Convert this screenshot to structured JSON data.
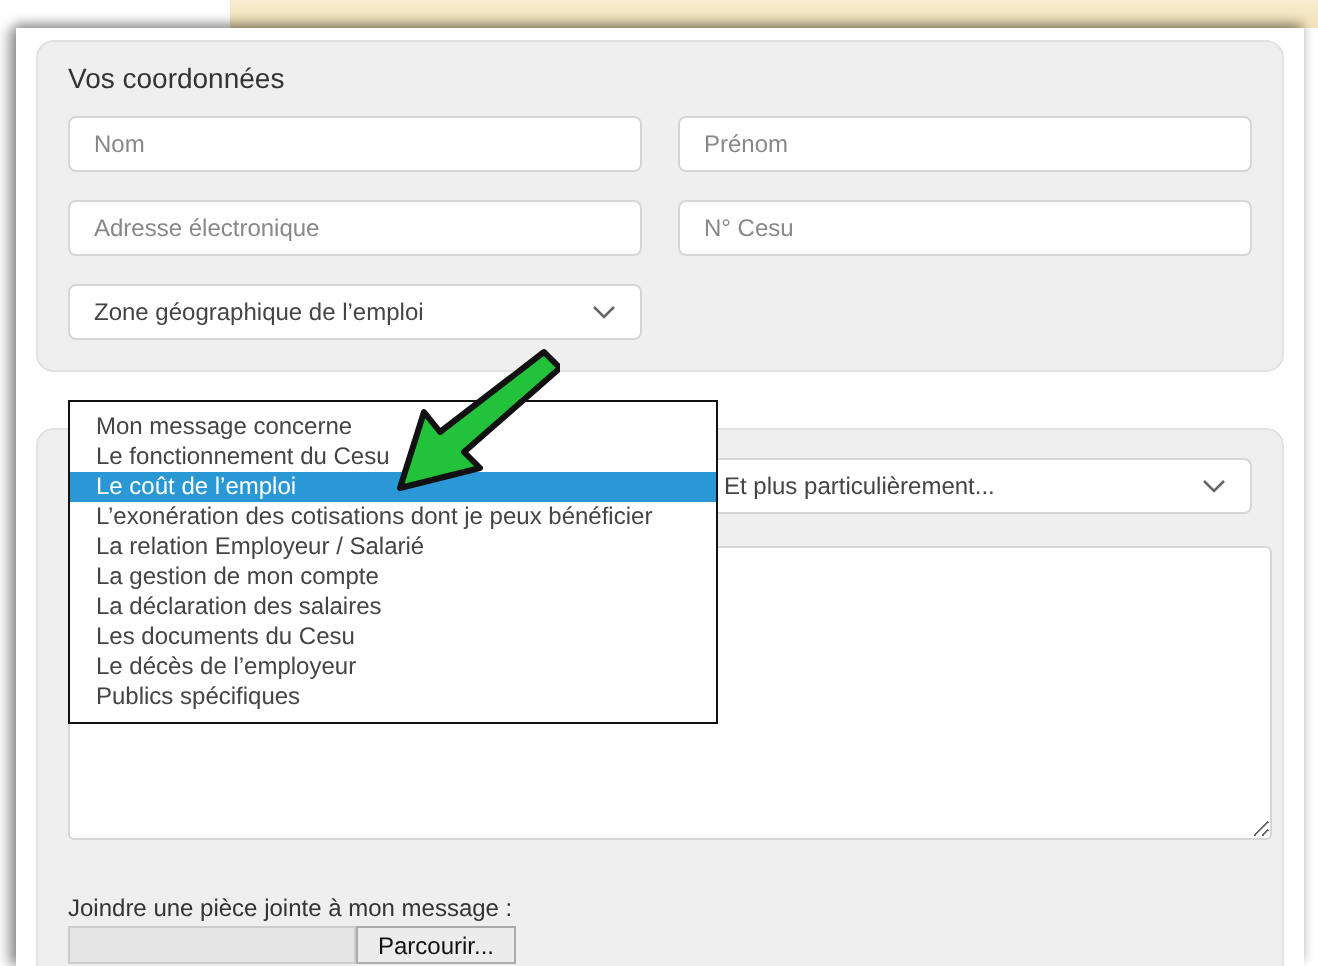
{
  "contact": {
    "title": "Vos coordonnées",
    "fields": [
      {
        "placeholder": "Nom"
      },
      {
        "placeholder": "Prénom"
      },
      {
        "placeholder": "Adresse électronique"
      },
      {
        "placeholder": "N° Cesu"
      }
    ],
    "zone_select": {
      "value": "Zone géographique de l’emploi"
    }
  },
  "message": {
    "topic_dropdown": {
      "options": [
        {
          "label": "Mon message concerne",
          "selected": false
        },
        {
          "label": "Le fonctionnement du Cesu",
          "selected": false
        },
        {
          "label": "Le coût de l’emploi",
          "selected": true
        },
        {
          "label": "L’exonération des cotisations dont je peux bénéficier",
          "selected": false
        },
        {
          "label": "La relation Employeur / Salarié",
          "selected": false
        },
        {
          "label": "La gestion de mon compte",
          "selected": false
        },
        {
          "label": "La déclaration des salaires",
          "selected": false
        },
        {
          "label": "Les documents du Cesu",
          "selected": false
        },
        {
          "label": "Le décès de l’employeur",
          "selected": false
        },
        {
          "label": "Publics spécifiques",
          "selected": false
        }
      ]
    },
    "subtopic_select": {
      "value": "Et plus particulièrement..."
    },
    "attachment": {
      "label": "Joindre une pièce jointe à mon message :",
      "button": "Parcourir..."
    }
  }
}
